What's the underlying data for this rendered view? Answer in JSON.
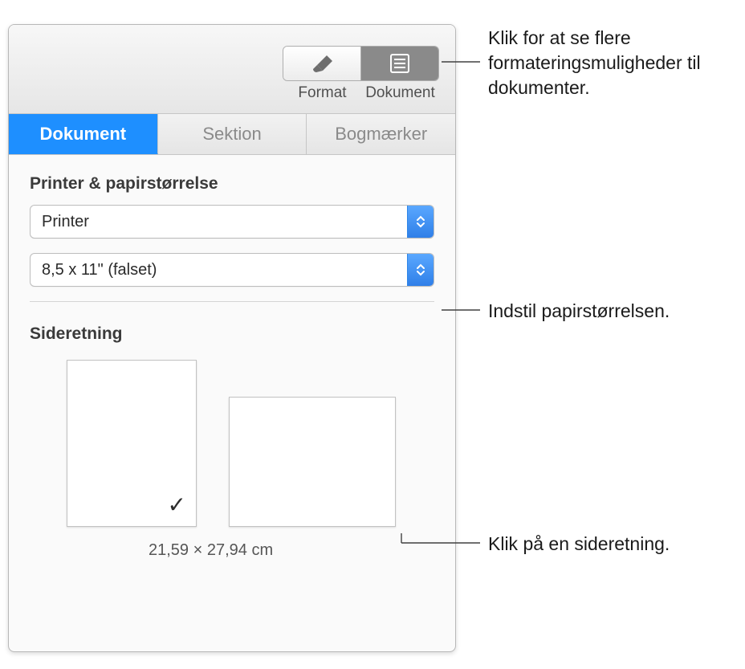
{
  "toolbar": {
    "format_label": "Format",
    "document_label": "Dokument"
  },
  "tabs": {
    "document": "Dokument",
    "section": "Sektion",
    "bookmarks": "Bogmærker"
  },
  "printer_section": {
    "title": "Printer & papirstørrelse",
    "printer_popup": "Printer",
    "paper_popup": "8,5 x 11\" (falset)"
  },
  "orientation_section": {
    "title": "Sideretning",
    "dimensions": "21,59 × 27,94 cm",
    "checkmark": "✓"
  },
  "callouts": {
    "toolbar": "Klik for at se flere formateringsmuligheder til dokumenter.",
    "paper": "Indstil papirstørrelsen.",
    "orient": "Klik på en sideretning."
  }
}
